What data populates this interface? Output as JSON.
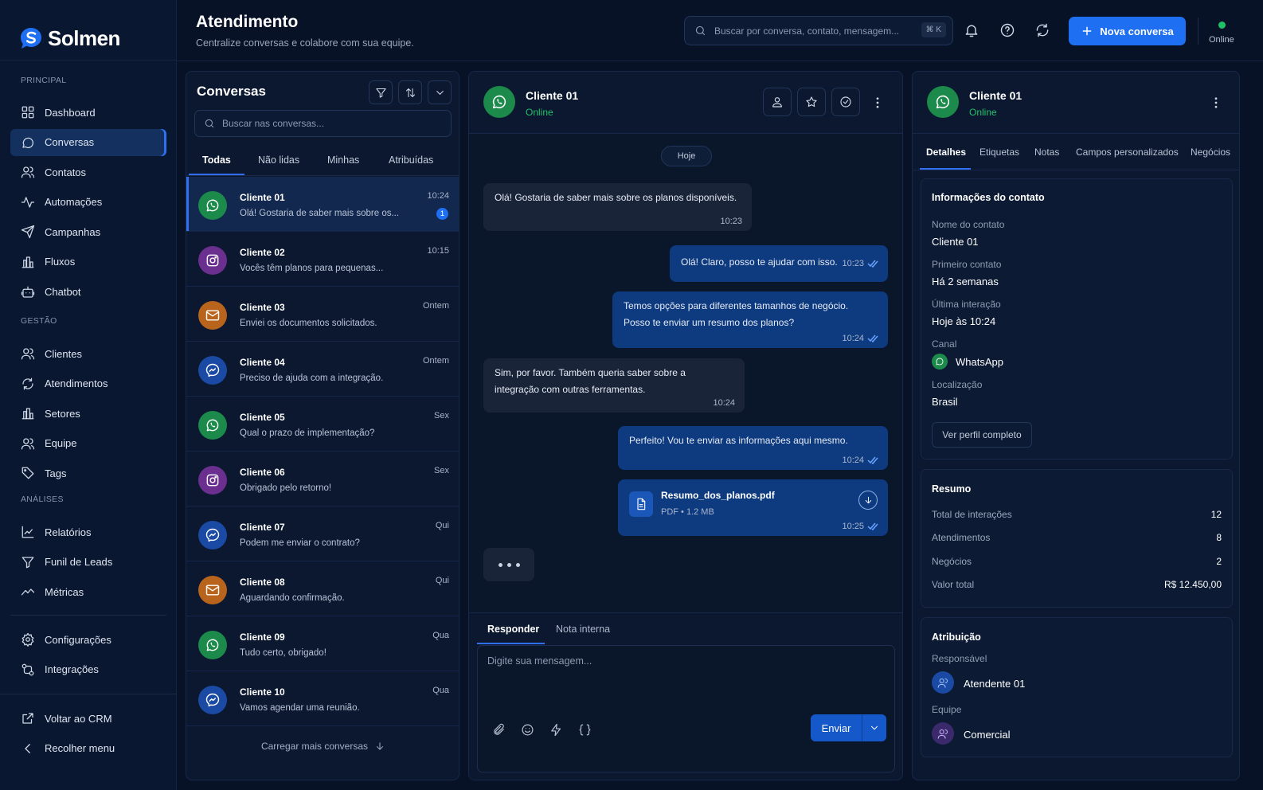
{
  "brand": {
    "name": "Solmen"
  },
  "sidebar": {
    "sections": [
      "PRINCIPAL",
      "GESTÃO",
      "ANÁLISES"
    ],
    "principal": [
      "Dashboard",
      "Conversas",
      "Contatos",
      "Automações",
      "Campanhas",
      "Fluxos",
      "Chatbot"
    ],
    "gestao": [
      "Clientes",
      "Atendimentos",
      "Setores",
      "Equipe",
      "Tags"
    ],
    "analises": [
      "Relatórios",
      "Funil de Leads",
      "Métricas"
    ],
    "config": [
      "Configurações",
      "Integrações"
    ],
    "bottom": [
      "Voltar ao CRM",
      "Recolher menu"
    ]
  },
  "header": {
    "title": "Atendimento",
    "subtitle": "Centralize conversas e colabore com sua equipe.",
    "search_placeholder": "Buscar por conversa, contato, mensagem...",
    "search_shortcut": "⌘ K",
    "new_button": "Nova conversa",
    "status": "Online"
  },
  "conversations": {
    "title": "Conversas",
    "search_placeholder": "Buscar nas conversas...",
    "tabs": [
      "Todas",
      "Não lidas",
      "Minhas",
      "Atribuídas"
    ],
    "items": [
      {
        "name": "Cliente 01",
        "preview": "Olá! Gostaria de saber mais sobre os...",
        "time": "10:24",
        "channel": "whatsapp",
        "unread": "1"
      },
      {
        "name": "Cliente 02",
        "preview": "Vocês têm planos para pequenas...",
        "time": "10:15",
        "channel": "instagram"
      },
      {
        "name": "Cliente 03",
        "preview": "Enviei os documentos solicitados.",
        "time": "Ontem",
        "channel": "email"
      },
      {
        "name": "Cliente 04",
        "preview": "Preciso de ajuda com a integração.",
        "time": "Ontem",
        "channel": "messenger"
      },
      {
        "name": "Cliente 05",
        "preview": "Qual o prazo de implementação?",
        "time": "Sex",
        "channel": "whatsapp"
      },
      {
        "name": "Cliente 06",
        "preview": "Obrigado pelo retorno!",
        "time": "Sex",
        "channel": "instagram"
      },
      {
        "name": "Cliente 07",
        "preview": "Podem me enviar o contrato?",
        "time": "Qui",
        "channel": "messenger"
      },
      {
        "name": "Cliente 08",
        "preview": "Aguardando confirmação.",
        "time": "Qui",
        "channel": "email"
      },
      {
        "name": "Cliente 09",
        "preview": "Tudo certo, obrigado!",
        "time": "Qua",
        "channel": "whatsapp"
      },
      {
        "name": "Cliente 10",
        "preview": "Vamos agendar uma reunião.",
        "time": "Qua",
        "channel": "messenger"
      }
    ],
    "load_more": "Carregar mais conversas"
  },
  "chat": {
    "name": "Cliente 01",
    "status": "Online",
    "date": "Hoje",
    "messages": [
      {
        "dir": "in",
        "text": "Olá! Gostaria de saber mais sobre os planos disponíveis.",
        "time": "10:23"
      },
      {
        "dir": "out",
        "text": "Olá! Claro, posso te ajudar com isso.",
        "time": "10:23"
      },
      {
        "dir": "out",
        "text": "Temos opções para diferentes tamanhos de negócio. Posso te enviar um resumo dos planos?",
        "time": "10:24"
      },
      {
        "dir": "in",
        "text": "Sim, por favor. Também queria saber sobre a integração com outras ferramentas.",
        "time": "10:24"
      },
      {
        "dir": "out",
        "text": "Perfeito! Vou te enviar as informações aqui mesmo.",
        "time": "10:24"
      }
    ],
    "file": {
      "name": "Resumo_dos_planos.pdf",
      "meta": "PDF • 1.2 MB",
      "time": "10:25"
    },
    "reply_tabs": [
      "Responder",
      "Nota interna"
    ],
    "input_placeholder": "Digite sua mensagem...",
    "send": "Enviar"
  },
  "details": {
    "name": "Cliente 01",
    "status": "Online",
    "tabs": [
      "Detalhes",
      "Etiquetas",
      "Notas",
      "Campos personalizados",
      "Negócios"
    ],
    "contact": {
      "title": "Informações do contato",
      "fields": [
        {
          "label": "Nome do contato",
          "value": "Cliente 01"
        },
        {
          "label": "Primeiro contato",
          "value": "Há 2 semanas"
        },
        {
          "label": "Última interação",
          "value": "Hoje às 10:24"
        },
        {
          "label": "Canal",
          "value": "WhatsApp"
        },
        {
          "label": "Localização",
          "value": "Brasil"
        }
      ],
      "profile_button": "Ver perfil completo"
    },
    "summary": {
      "title": "Resumo",
      "rows": [
        {
          "label": "Total de interações",
          "value": "12"
        },
        {
          "label": "Atendimentos",
          "value": "8"
        },
        {
          "label": "Negócios",
          "value": "2"
        },
        {
          "label": "Valor total",
          "value": "R$ 12.450,00"
        }
      ]
    },
    "assignment": {
      "title": "Atribuição",
      "responsible_label": "Responsável",
      "responsible": "Atendente 01",
      "team_label": "Equipe",
      "team": "Comercial"
    }
  },
  "colors": {
    "accent": "#1f6ff2",
    "online": "#22c06a",
    "whatsapp": "#1c8a4b",
    "instagram": "#6b2f8f",
    "email": "#b8641c",
    "messenger": "#1a4aa3"
  }
}
